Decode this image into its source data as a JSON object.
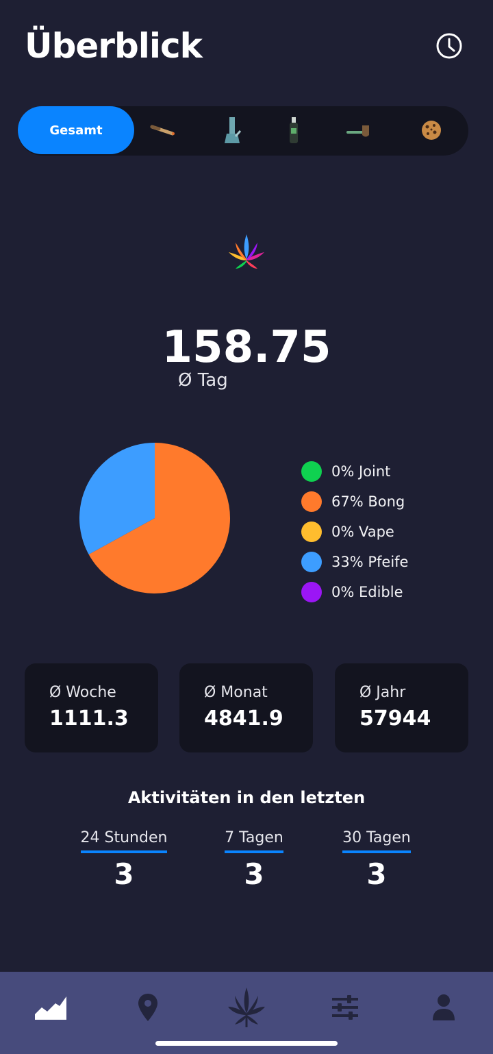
{
  "header": {
    "title": "Überblick",
    "history_icon": "clock-icon"
  },
  "tabs": {
    "active_label": "Gesamt",
    "icons": [
      "joint-icon",
      "bong-icon",
      "vape-icon",
      "pipe-icon",
      "edible-cookie-icon"
    ]
  },
  "summary": {
    "logo_icon": "cannabis-leaf-icon",
    "value": "158.75",
    "label": "Ø Tag"
  },
  "chart_data": {
    "type": "pie",
    "slices": [
      {
        "label": "0% Joint",
        "name": "Joint",
        "value": 0,
        "color": "#0fd150"
      },
      {
        "label": "67% Bong",
        "name": "Bong",
        "value": 67,
        "color": "#ff7a2c"
      },
      {
        "label": "0% Vape",
        "name": "Vape",
        "value": 0,
        "color": "#ffbd2e"
      },
      {
        "label": "33% Pfeife",
        "name": "Pfeife",
        "value": 33,
        "color": "#3d9dff"
      },
      {
        "label": "0% Edible",
        "name": "Edible",
        "value": 0,
        "color": "#9b16f5"
      }
    ]
  },
  "stats": [
    {
      "label": "Ø Woche",
      "value": "1111.3"
    },
    {
      "label": "Ø Monat",
      "value": "4841.9"
    },
    {
      "label": "Ø Jahr",
      "value": "57944"
    }
  ],
  "activity": {
    "title": "Aktivitäten in den letzten",
    "items": [
      {
        "label": "24 Stunden",
        "value": "3"
      },
      {
        "label": "7 Tagen",
        "value": "3"
      },
      {
        "label": "30 Tagen",
        "value": "3"
      }
    ]
  },
  "bottom_nav": {
    "items": [
      "statistics-icon",
      "location-pin-icon",
      "cannabis-leaf-icon",
      "sliders-icon",
      "user-icon"
    ]
  },
  "colors": {
    "background": "#1e1f33",
    "card": "#13141f",
    "accent": "#0a84ff",
    "nav": "#474b7c"
  }
}
